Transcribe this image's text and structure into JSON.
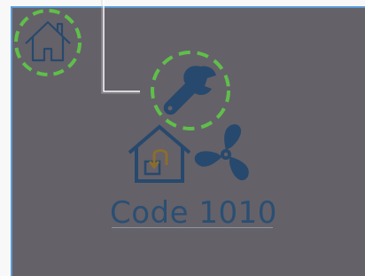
{
  "status": {
    "code_text": "Code 1010"
  },
  "icons": {
    "home": "home-icon",
    "wrench": "wrench-icon",
    "service": "house-with-arrow-icon",
    "fan": "fan-icon"
  },
  "colors": {
    "panel_background": "#656169",
    "icon_blue": "#27496d",
    "highlight_green": "#5fbf4a",
    "arrow_brown": "#8a6d2e",
    "panel_border": "#5b9bd5"
  }
}
